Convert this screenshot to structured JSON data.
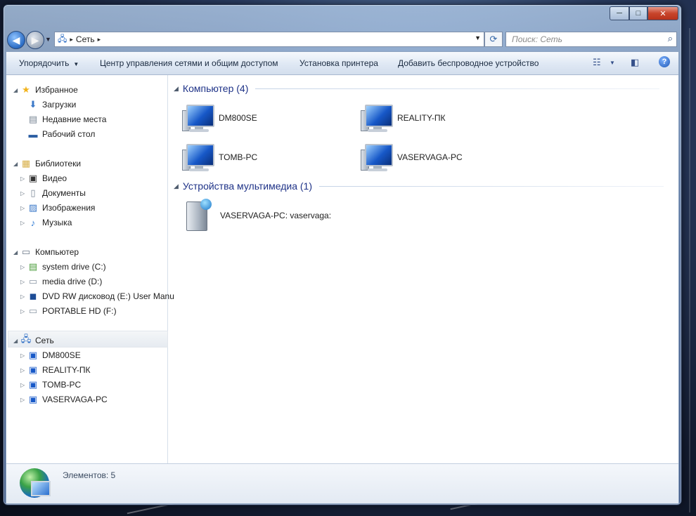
{
  "window": {
    "caption_buttons": [
      "─",
      "□",
      "✕"
    ]
  },
  "address": {
    "icon": "network-icon",
    "path": "Сеть",
    "separator": "▸"
  },
  "search": {
    "placeholder": "Поиск: Сеть"
  },
  "toolbar": {
    "organize": "Упорядочить",
    "network_center": "Центр управления сетями и общим доступом",
    "add_printer": "Установка принтера",
    "add_wireless": "Добавить беспроводное устройство"
  },
  "nav": {
    "favorites": {
      "label": "Избранное",
      "items": [
        "Загрузки",
        "Недавние места",
        "Рабочий стол"
      ]
    },
    "libraries": {
      "label": "Библиотеки",
      "items": [
        "Видео",
        "Документы",
        "Изображения",
        "Музыка"
      ]
    },
    "computer": {
      "label": "Компьютер",
      "items": [
        "system drive (C:)",
        "media drive (D:)",
        "DVD RW дисковод (E:) User Manu",
        "PORTABLE HD (F:)"
      ]
    },
    "network": {
      "label": "Сеть",
      "items": [
        "DM800SE",
        "REALITY-ПК",
        "TOMB-PC",
        "VASERVAGA-PC"
      ]
    }
  },
  "content": {
    "computers_group": "Компьютер (4)",
    "computers": [
      "DM800SE",
      "REALITY-ПК",
      "TOMB-PC",
      "VASERVAGA-PC"
    ],
    "media_group": "Устройства мультимедиа (1)",
    "media": [
      "VASERVAGA-PC: vaservaga:"
    ]
  },
  "status": {
    "count": "Элементов: 5"
  }
}
